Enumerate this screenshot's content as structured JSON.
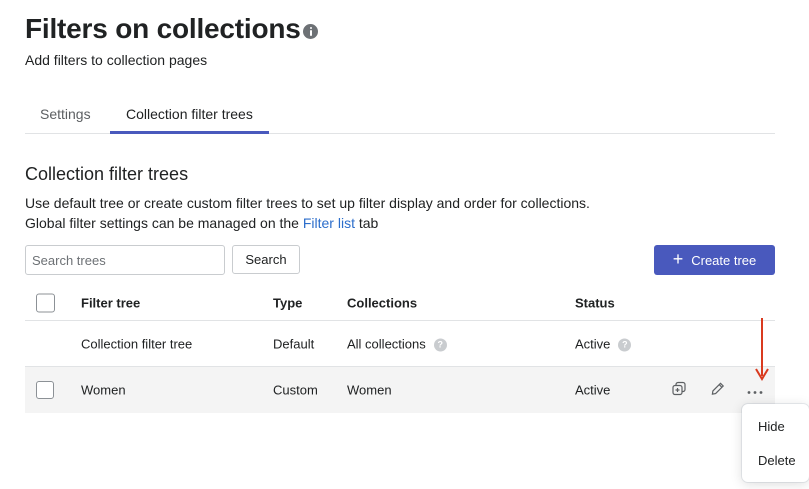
{
  "page": {
    "title": "Filters on collections",
    "subtitle": "Add filters to collection pages"
  },
  "tabs": [
    {
      "label": "Settings"
    },
    {
      "label": "Collection filter trees"
    }
  ],
  "section": {
    "title": "Collection filter trees",
    "desc_line1": "Use default tree or create custom filter trees to set up filter display and order for collections.",
    "desc_line2_prefix": "Global filter settings can be managed on the ",
    "desc_link": "Filter list",
    "desc_line2_suffix": " tab"
  },
  "search": {
    "placeholder": "Search trees",
    "button_label": "Search"
  },
  "create_button": {
    "label": "Create tree",
    "icon": "plus-icon"
  },
  "table": {
    "columns": [
      "Filter tree",
      "Type",
      "Collections",
      "Status"
    ],
    "rows": [
      {
        "name": "Collection filter tree",
        "type": "Default",
        "collections": "All collections",
        "status": "Active",
        "help": "?"
      },
      {
        "name": "Women",
        "type": "Custom",
        "collections": "Women",
        "status": "Active"
      }
    ]
  },
  "dropdown": {
    "items": [
      "Hide",
      "Delete"
    ]
  },
  "colors": {
    "accent": "#4959bd",
    "link": "#2c6ecb",
    "annotation_arrow": "#d93a1f"
  }
}
